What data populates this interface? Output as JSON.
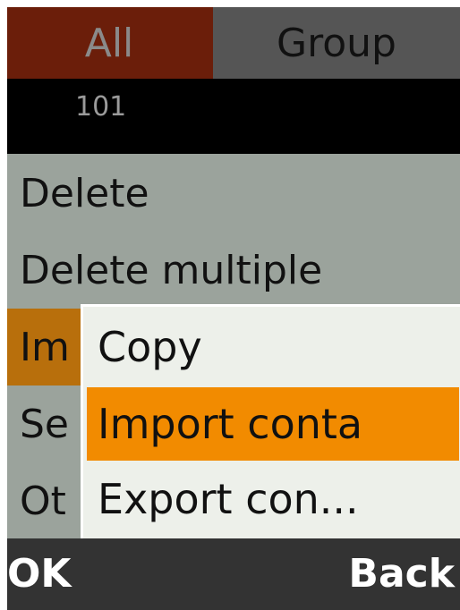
{
  "tabs": {
    "all": "All",
    "group": "Group"
  },
  "number_bar": {
    "value": "101"
  },
  "menu": {
    "items": [
      "Delete",
      "Delete multiple",
      "Im",
      "Se",
      "Ot"
    ]
  },
  "submenu": {
    "items": [
      "Copy",
      "Import conta",
      "Export con..."
    ],
    "selected_index": 1
  },
  "softkeys": {
    "left": "OK",
    "right": "Back"
  },
  "colors": {
    "tab_active": "#6b1e0a",
    "highlight": "#f28b00",
    "menu_bg": "#9ba39c",
    "submenu_bg": "#edf0ea"
  }
}
